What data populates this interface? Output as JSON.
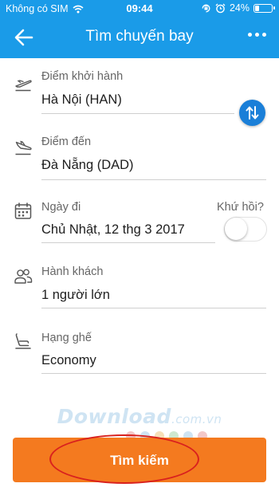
{
  "status_bar": {
    "carrier": "Không có SIM",
    "time": "09:44",
    "battery_percent": "24%",
    "battery_level": 0.24
  },
  "header": {
    "title": "Tìm chuyến bay",
    "background_color": "#1a9be8"
  },
  "form": {
    "origin": {
      "label": "Điểm khởi hành",
      "value": "Hà Nội (HAN)"
    },
    "destination": {
      "label": "Điểm đến",
      "value": "Đà Nẵng (DAD)"
    },
    "departure_date": {
      "label": "Ngày đi",
      "value": "Chủ Nhật, 12 thg 3 2017"
    },
    "round_trip": {
      "label": "Khứ hồi?",
      "enabled": false
    },
    "passengers": {
      "label": "Hành khách",
      "value": "1 người lớn"
    },
    "seat_class": {
      "label": "Hạng ghế",
      "value": "Economy"
    }
  },
  "search_button": {
    "label": "Tìm kiếm",
    "color": "#f47a1f"
  },
  "watermark": {
    "text": "Download",
    "suffix": ".com.vn"
  },
  "icons": [
    "back-arrow-icon",
    "more-icon",
    "takeoff-icon",
    "landing-icon",
    "swap-icon",
    "calendar-icon",
    "passengers-icon",
    "seat-icon"
  ]
}
